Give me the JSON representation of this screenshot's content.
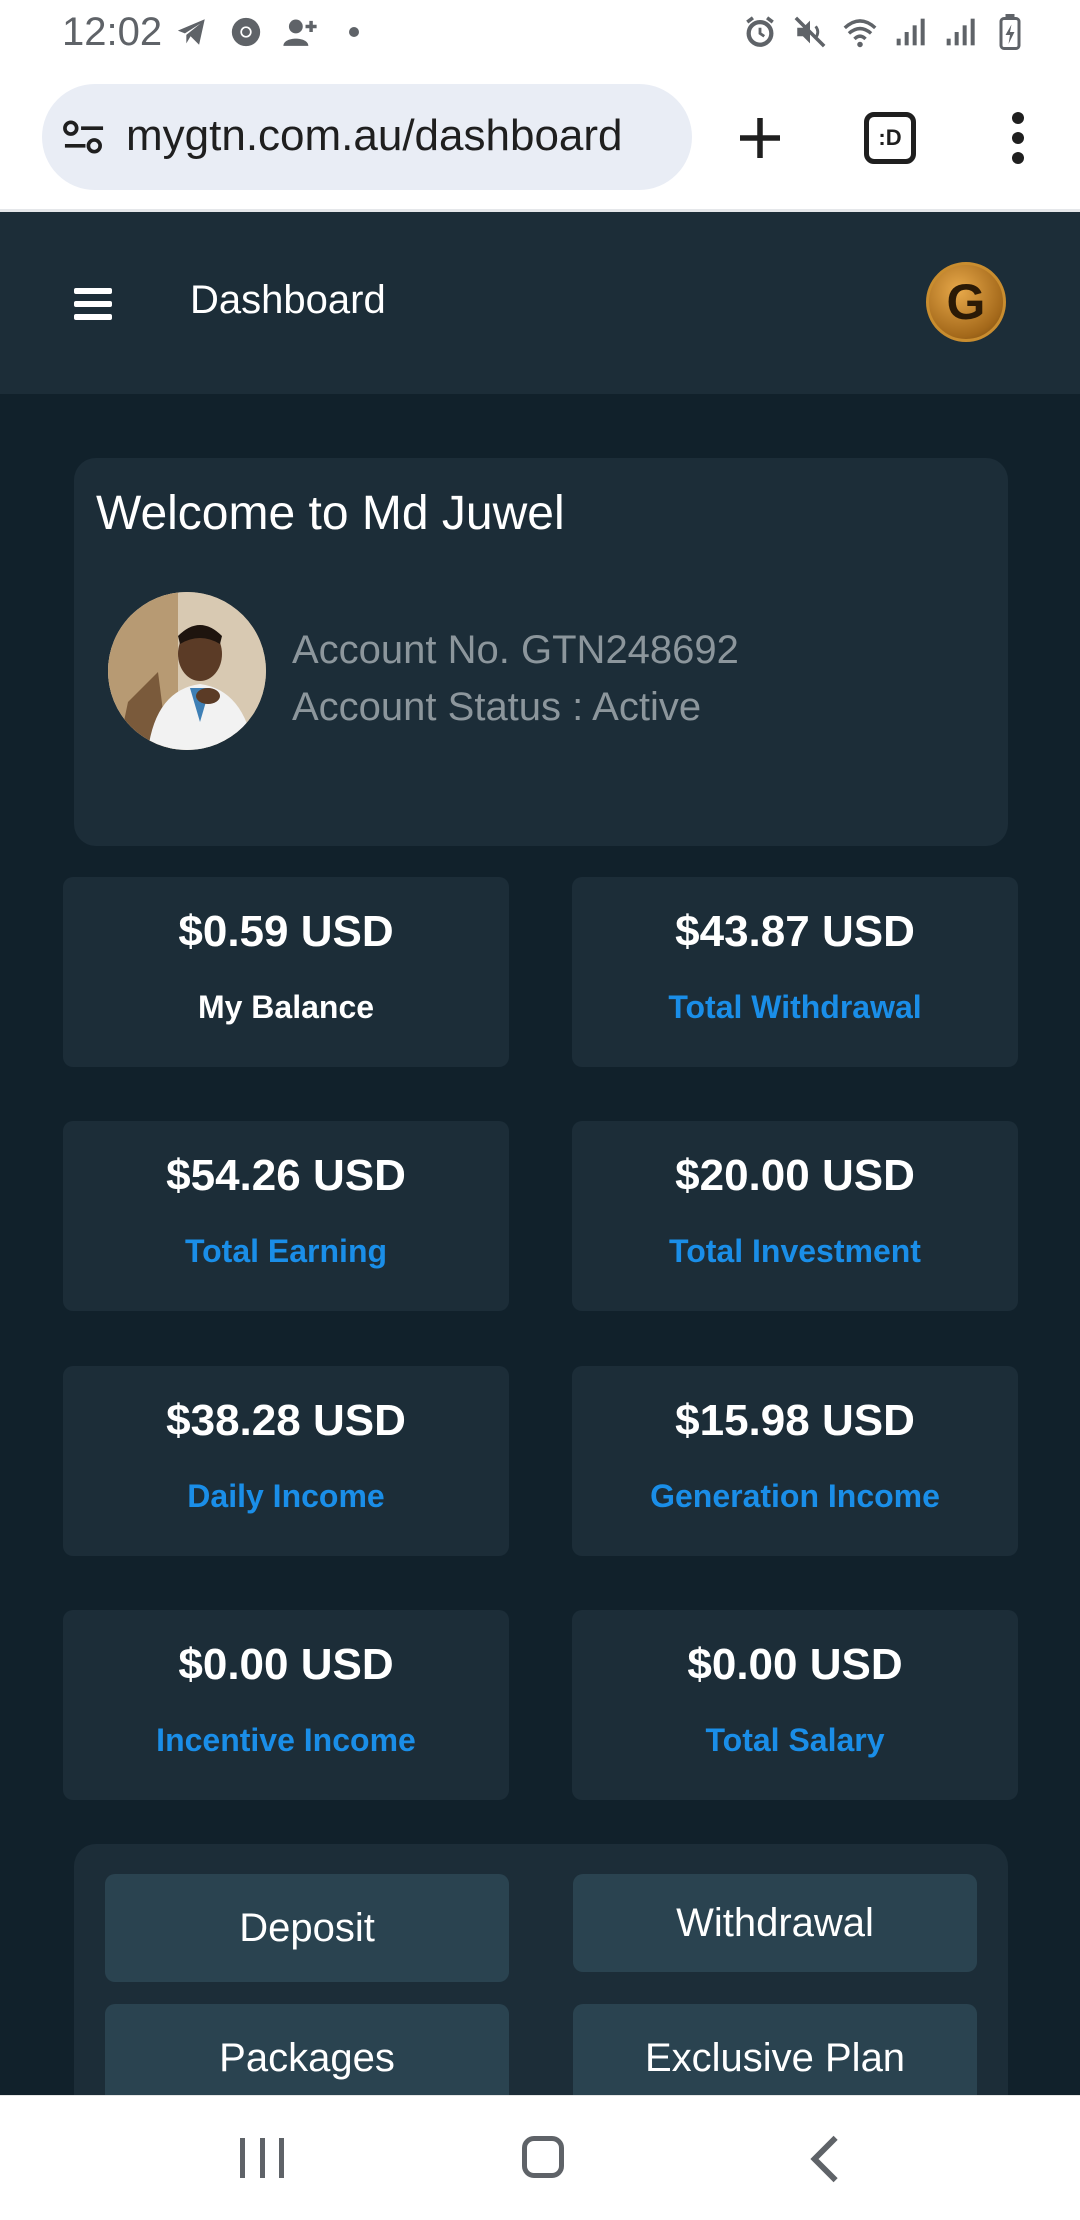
{
  "status_bar": {
    "time": "12:02",
    "left_icons": [
      "telegram-icon",
      "chrome-icon",
      "contact-add-icon",
      "dot-icon"
    ],
    "right_icons": [
      "alarm-icon",
      "mute-icon",
      "wifi-icon",
      "signal-icon",
      "signal-icon",
      "battery-icon"
    ]
  },
  "browser": {
    "url": "mygtn.com.au/dashboard",
    "tab_label": ":D"
  },
  "header": {
    "title": "Dashboard",
    "logo_letter": "G"
  },
  "welcome": {
    "title": "Welcome to Md Juwel",
    "account_no": "Account No. GTN248692",
    "account_status": "Account Status : Active"
  },
  "stats": [
    {
      "value": "$0.59 USD",
      "label": "My Balance"
    },
    {
      "value": "$43.87 USD",
      "label": "Total Withdrawal"
    },
    {
      "value": "$54.26 USD",
      "label": "Total Earning"
    },
    {
      "value": "$20.00 USD",
      "label": "Total Investment"
    },
    {
      "value": "$38.28 USD",
      "label": "Daily Income"
    },
    {
      "value": "$15.98 USD",
      "label": "Generation Income"
    },
    {
      "value": "$0.00 USD",
      "label": "Incentive Income"
    },
    {
      "value": "$0.00 USD",
      "label": "Total Salary"
    }
  ],
  "actions": [
    "Deposit",
    "Withdrawal",
    "Packages",
    "Exclusive Plan"
  ],
  "colors": {
    "app_bg": "#11212b",
    "card_bg": "#1c2d38",
    "button_bg": "#2a4350",
    "accent_blue": "#1a8ee8"
  }
}
